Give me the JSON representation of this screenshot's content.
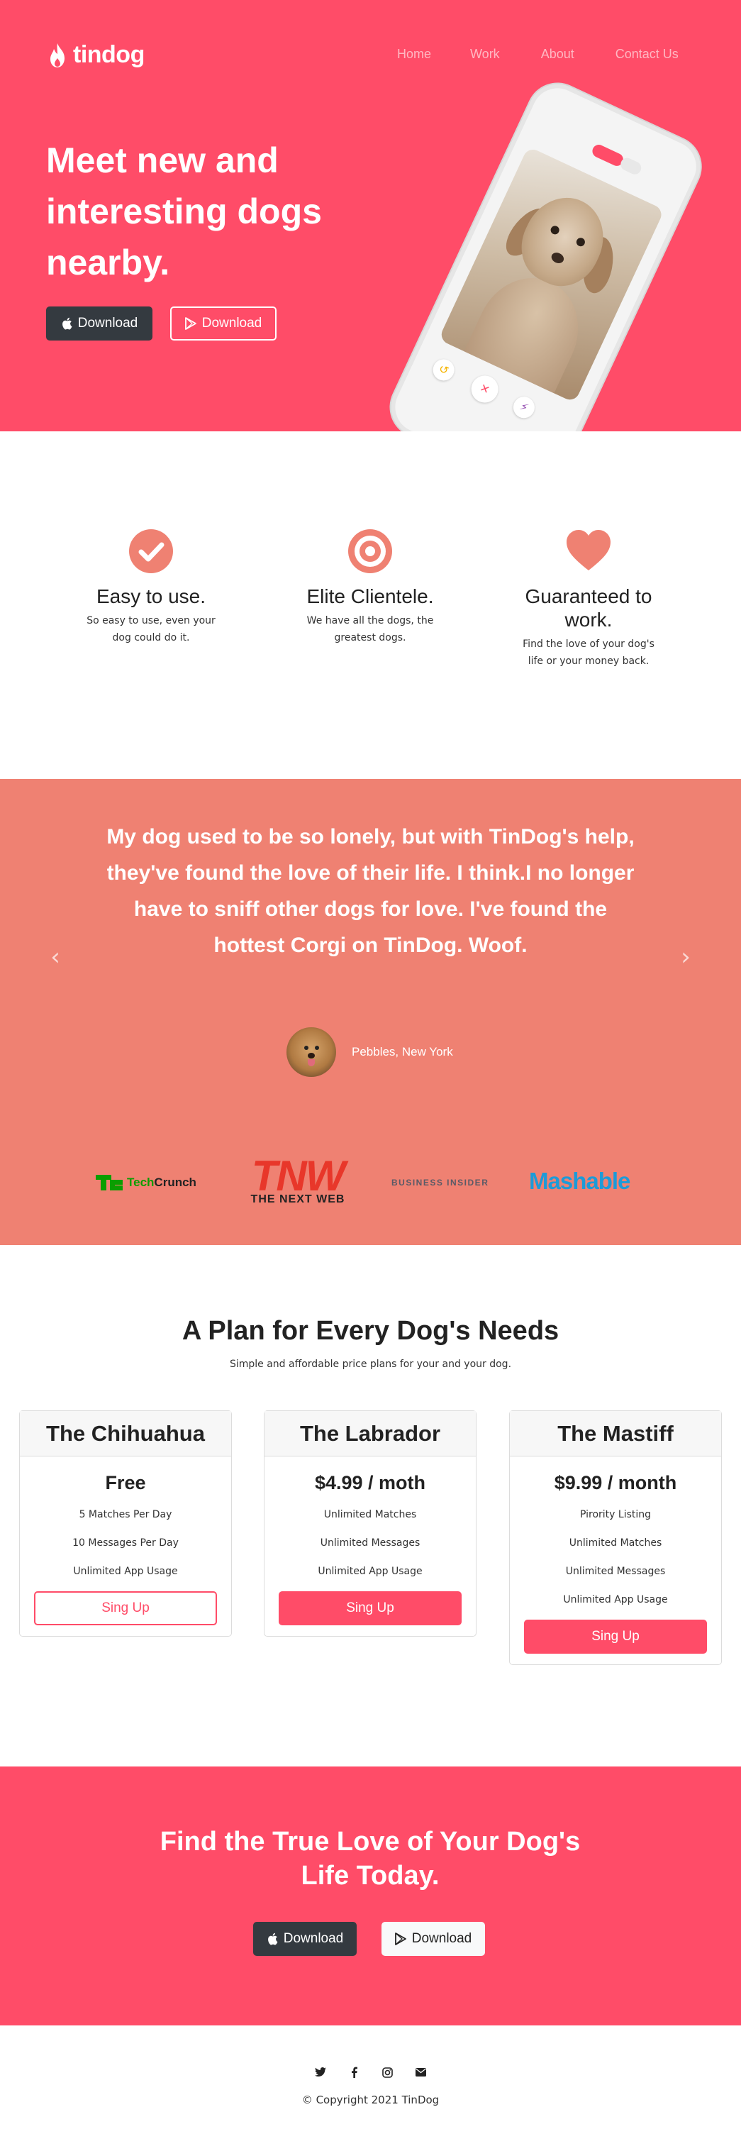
{
  "brand": {
    "name": "tindog"
  },
  "nav": {
    "items": [
      "Home",
      "Work",
      "About",
      "Contact Us"
    ]
  },
  "hero": {
    "title": "Meet new and interesting dogs nearby.",
    "buttons": {
      "apple": "Download",
      "play": "Download"
    }
  },
  "features": [
    {
      "icon": "check-circle-icon",
      "title": "Easy to use.",
      "text": "So easy to use, even your dog could do it."
    },
    {
      "icon": "bullseye-icon",
      "title": "Elite Clientele.",
      "text": "We have all the dogs, the greatest dogs."
    },
    {
      "icon": "heart-icon",
      "title": "Guaranteed to work.",
      "text": "Find the love of your dog's life or your money back."
    }
  ],
  "testimonial": {
    "quote": "My dog used to be so lonely, but with TinDog's help, they've found the love of their life. I think.I no longer have to sniff other dogs for love. I've found the hottest Corgi on TinDog. Woof.",
    "author": "Pebbles, New York"
  },
  "press": {
    "techcrunch": {
      "a": "Tech",
      "b": "Crunch"
    },
    "tnw": {
      "big": "TNW",
      "small": "THE NEXT WEB"
    },
    "business_insider": "BUSINESS INSIDER",
    "mashable": "Mashable"
  },
  "pricing": {
    "title": "A Plan for Every Dog's Needs",
    "subtitle": "Simple and affordable price plans for your and your dog.",
    "plans": [
      {
        "name": "The Chihuahua",
        "price": "Free",
        "features": [
          "5 Matches Per Day",
          "10 Messages Per Day",
          "Unlimited App Usage"
        ],
        "button": "Sing Up"
      },
      {
        "name": "The Labrador",
        "price": "$4.99 / moth",
        "features": [
          "Unlimited Matches",
          "Unlimited Messages",
          "Unlimited App Usage"
        ],
        "button": "Sing Up"
      },
      {
        "name": "The Mastiff",
        "price": "$9.99 / month",
        "features": [
          "Pirority Listing",
          "Unlimited Matches",
          "Unlimited Messages",
          "Unlimited App Usage"
        ],
        "button": "Sing Up"
      }
    ]
  },
  "cta": {
    "title": "Find the True Love of Your Dog's Life Today.",
    "buttons": {
      "apple": "Download",
      "play": "Download"
    }
  },
  "footer": {
    "socials": [
      "twitter-icon",
      "facebook-icon",
      "instagram-icon",
      "envelope-icon"
    ],
    "copyright": "© Copyright 2021 TinDog"
  },
  "colors": {
    "primary": "#ff4c68",
    "testimonial_bg": "#ef8172",
    "icon": "#ef8172",
    "dark_button": "#343a40"
  }
}
